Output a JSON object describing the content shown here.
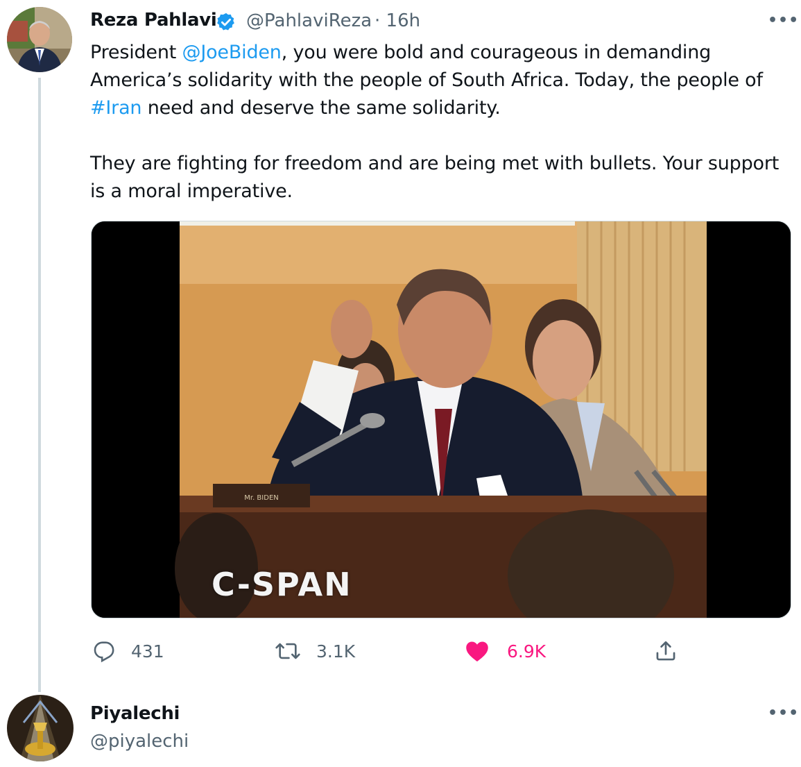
{
  "tweet": {
    "author": {
      "name": "Reza Pahlavi",
      "handle": "@PahlaviReza",
      "time": "· 16h",
      "verified": true
    },
    "more": "•••",
    "text": {
      "p1_before": "President ",
      "mention": "@JoeBiden",
      "p1_middle": ", you were bold and courageous in demanding America’s solidarity with the people of South Africa. Today, the people of ",
      "hashtag": "#Iran",
      "p1_after": " need and deserve the same solidarity.",
      "p2": "They are fighting for freedom and are being met with bullets. Your support is a moral imperative."
    },
    "media": {
      "overlay": "C-SPAN"
    },
    "actions": {
      "reply": {
        "icon": "reply-icon",
        "count": "431"
      },
      "retweet": {
        "icon": "retweet-icon",
        "count": "3.1K"
      },
      "like": {
        "icon": "heart-icon",
        "count": "6.9K",
        "liked": true
      },
      "share": {
        "icon": "share-icon"
      }
    }
  },
  "reply": {
    "author": {
      "name": "Piyalechi",
      "handle": "@piyalechi"
    },
    "more": "•••"
  },
  "colors": {
    "link": "#1d9bf0",
    "like": "#f91880",
    "verified": "#1d9bf0",
    "muted": "#536471"
  }
}
